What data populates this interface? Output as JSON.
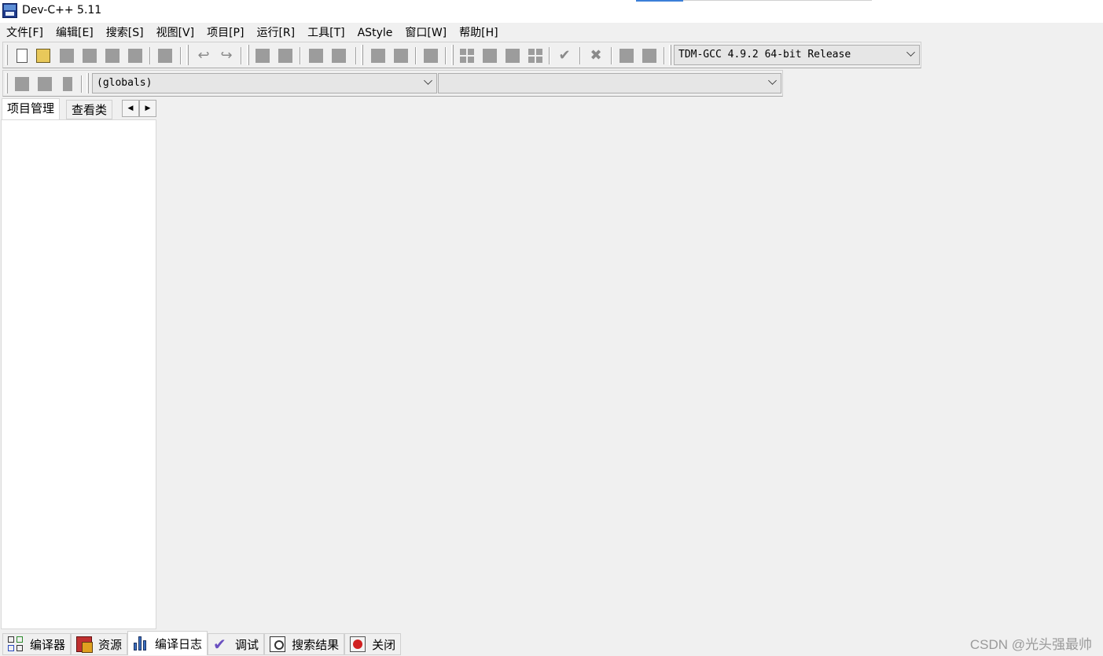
{
  "window": {
    "title": "Dev-C++ 5.11"
  },
  "menu": [
    {
      "label": "文件[F]"
    },
    {
      "label": "编辑[E]"
    },
    {
      "label": "搜索[S]"
    },
    {
      "label": "视图[V]"
    },
    {
      "label": "项目[P]"
    },
    {
      "label": "运行[R]"
    },
    {
      "label": "工具[T]"
    },
    {
      "label": "AStyle"
    },
    {
      "label": "窗口[W]"
    },
    {
      "label": "帮助[H]"
    }
  ],
  "toolbar": {
    "compiler_select": "TDM-GCC 4.9.2 64-bit Release",
    "scope_select": "(globals)",
    "member_select": ""
  },
  "left_panel": {
    "tabs": [
      {
        "label": "项目管理"
      },
      {
        "label": "查看类"
      }
    ]
  },
  "bottom_tabs": [
    {
      "label": "编译器",
      "icon": "grid-icon"
    },
    {
      "label": "资源",
      "icon": "resources-icon"
    },
    {
      "label": "编译日志",
      "icon": "bar-chart-icon"
    },
    {
      "label": "调试",
      "icon": "check-icon"
    },
    {
      "label": "搜索结果",
      "icon": "search-icon"
    },
    {
      "label": "关闭",
      "icon": "close-icon"
    }
  ],
  "watermark": "CSDN @光头强最帅"
}
